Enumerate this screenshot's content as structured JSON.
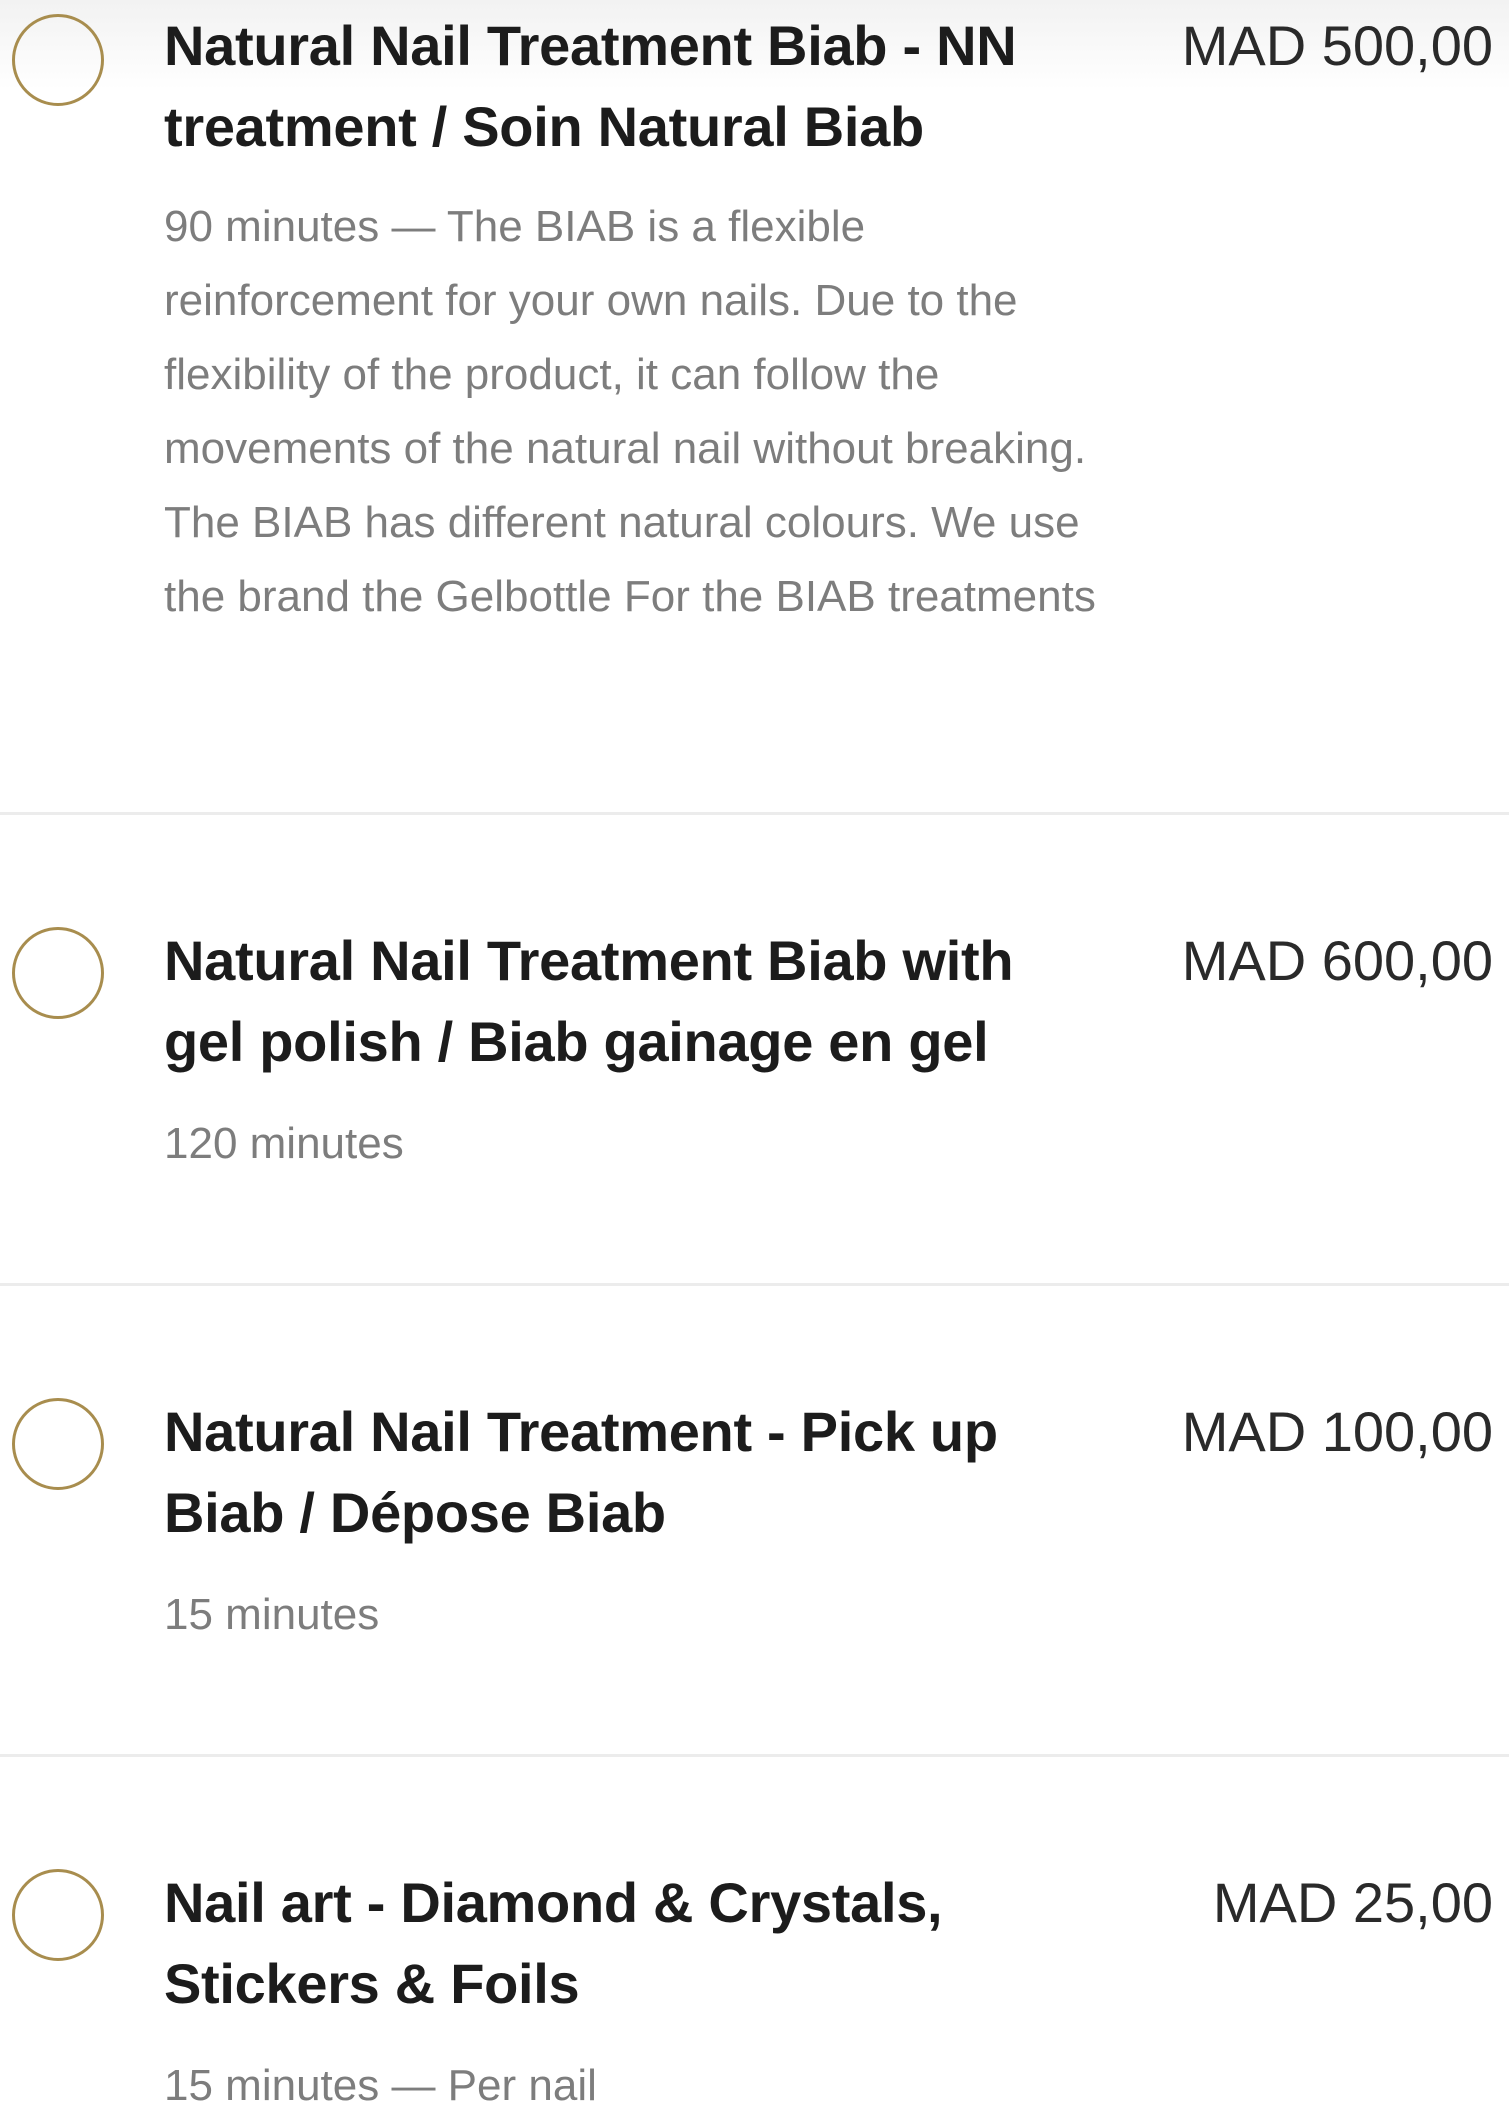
{
  "services": [
    {
      "title": "Natural Nail Treatment Biab - NN treatment / Soin Natural Biab",
      "price": "MAD 500,00",
      "description": "90 minutes — The BIAB is a flexible reinforcement for your own nails. Due to the flexibility of the product, it can follow the movements of the natural nail without breaking. The BIAB has different natural colours. We use the brand the Gelbottle For the BIAB treatments"
    },
    {
      "title": "Natural Nail Treatment Biab with gel polish / Biab gainage en gel",
      "price": "MAD 600,00",
      "description": "120 minutes"
    },
    {
      "title": "Natural Nail Treatment - Pick up Biab / Dépose Biab",
      "price": "MAD 100,00",
      "description": "15 minutes"
    },
    {
      "title": "Nail art - Diamond & Crystals, Stickers & Foils",
      "price": "MAD 25,00",
      "description": "15 minutes — Per nail"
    }
  ],
  "colors": {
    "radio_border": "#a88d4e",
    "title_text": "#1c1c1c",
    "description_text": "#7d7d7d",
    "divider": "#ececec"
  }
}
